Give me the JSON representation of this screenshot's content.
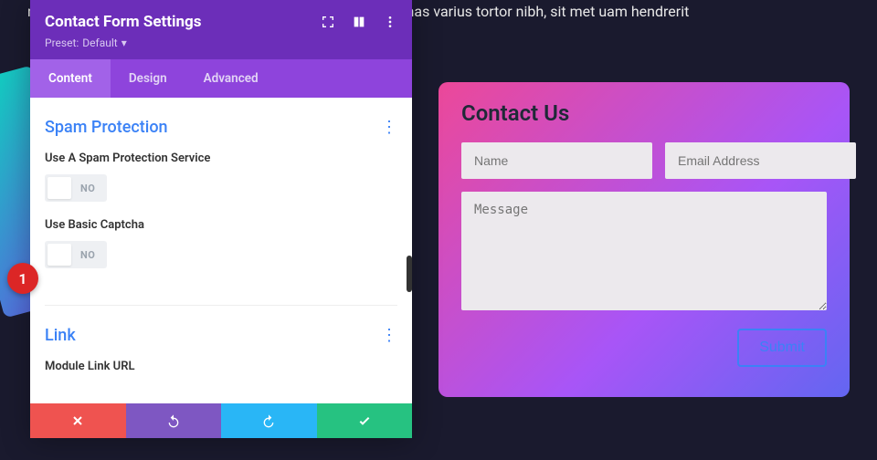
{
  "bg_text": "m ipsum dolor sit amet, consectetur adipiscing elit. Maecenas varius tortor nibh, sit met                                                                                                                           uam hendrerit",
  "badge": "1",
  "panel": {
    "title": "Contact Form Settings",
    "preset_label": "Preset:",
    "preset_value": "Default",
    "tabs": {
      "content": "Content",
      "design": "Design",
      "advanced": "Advanced"
    },
    "sections": {
      "spam": {
        "title": "Spam Protection",
        "field1": "Use A Spam Protection Service",
        "field2": "Use Basic Captcha",
        "toggle_off": "NO"
      },
      "link": {
        "title": "Link",
        "field1": "Module Link URL"
      }
    }
  },
  "contact": {
    "title": "Contact Us",
    "name_ph": "Name",
    "email_ph": "Email Address",
    "message_ph": "Message",
    "submit": "Submit"
  }
}
